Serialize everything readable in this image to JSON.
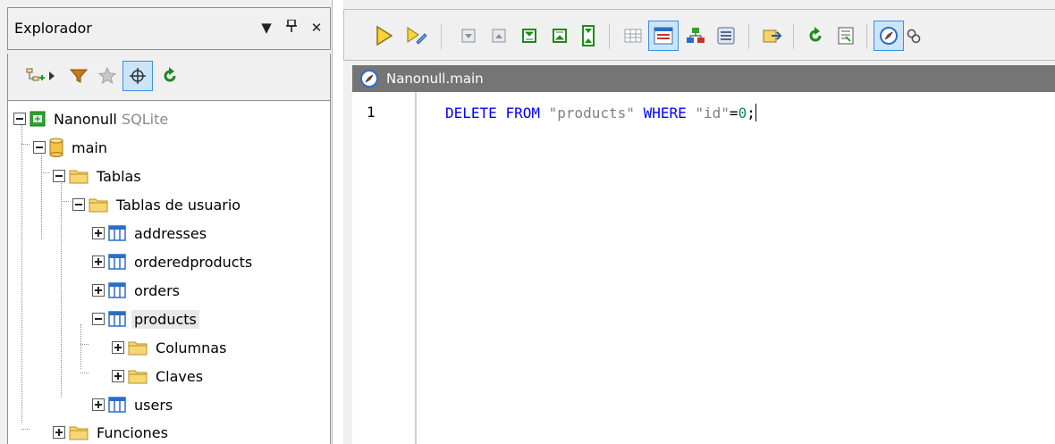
{
  "explorer": {
    "title": "Explorador",
    "buttons": [
      "dropdown",
      "pin",
      "close"
    ],
    "toolbar": [
      "add-connection-icon",
      "filter-icon",
      "favorites-icon",
      "locate-icon",
      "refresh-icon"
    ]
  },
  "tree": {
    "root": {
      "label": "Nanonull",
      "sub": "SQLite"
    },
    "main": "main",
    "tablas": "Tablas",
    "tablas_usuario": "Tablas de usuario",
    "addresses": "addresses",
    "orderedproducts": "orderedproducts",
    "orders": "orders",
    "products": "products",
    "columnas": "Columnas",
    "claves": "Claves",
    "users": "users",
    "funciones": "Funciones"
  },
  "editor": {
    "tab_title": "Nanonull.main",
    "line_number": "1",
    "code": {
      "delete": "DELETE",
      "from": "FROM",
      "table": "\"products\"",
      "where": "WHERE",
      "column": "\"id\"",
      "equals": "=",
      "value": "0",
      "semicolon": ";"
    }
  },
  "colors": {
    "keyword": "#0000ff",
    "string": "#808080",
    "number": "#09885a",
    "tab_bg": "#757575",
    "active_button_bg": "#cce4f7"
  }
}
